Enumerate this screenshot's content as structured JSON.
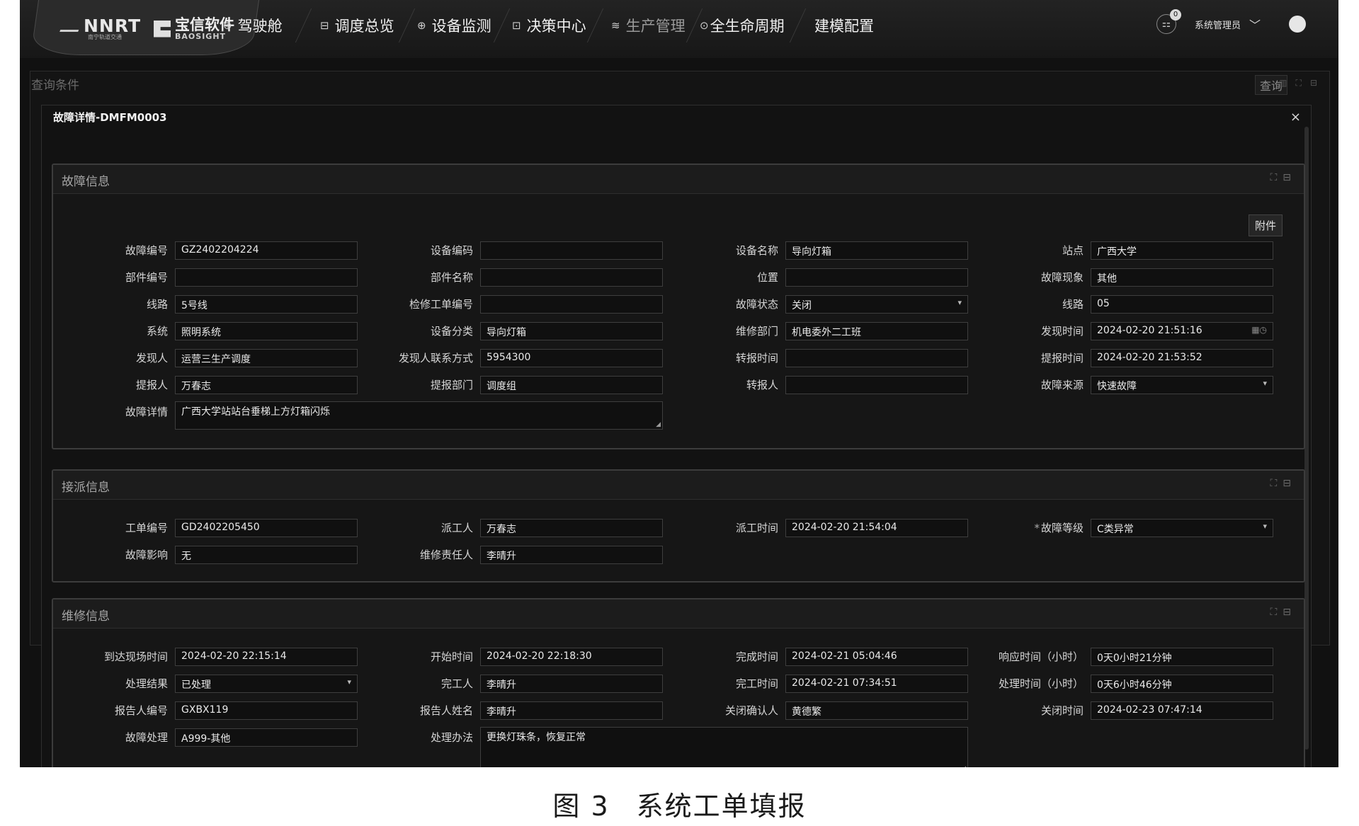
{
  "brand": {
    "logo_main": "NNRT",
    "logo_sub": "南宁轨道交通",
    "partner_cn": "宝信软件",
    "partner_en": "BAOSIGHT"
  },
  "nav": {
    "items": [
      {
        "label": "驾驶舱",
        "icon": "dashboard-icon"
      },
      {
        "label": "调度总览",
        "icon": "monitor-icon"
      },
      {
        "label": "设备监测",
        "icon": "target-icon"
      },
      {
        "label": "决策中心",
        "icon": "chart-icon"
      },
      {
        "label": "生产管理",
        "icon": "layers-icon"
      },
      {
        "label": "全生命周期",
        "icon": "cycle-icon"
      },
      {
        "label": "建模配置",
        "icon": ""
      }
    ],
    "notification_count": "0",
    "user": "系统管理员"
  },
  "query": {
    "title": "查询条件",
    "search_label": "查询"
  },
  "modal": {
    "title": "故障详情-DMFM0003",
    "close": "×"
  },
  "fault": {
    "title": "故障信息",
    "attach": "附件",
    "fields": {
      "fault_no": {
        "label": "故障编号",
        "value": "GZ2402204224"
      },
      "equip_code": {
        "label": "设备编码",
        "value": ""
      },
      "equip_name": {
        "label": "设备名称",
        "value": "导向灯箱"
      },
      "station": {
        "label": "站点",
        "value": "广西大学"
      },
      "part_no": {
        "label": "部件编号",
        "value": ""
      },
      "part_name": {
        "label": "部件名称",
        "value": ""
      },
      "position": {
        "label": "位置",
        "value": ""
      },
      "phenomenon": {
        "label": "故障现象",
        "value": "其他"
      },
      "line": {
        "label": "线路",
        "value": "5号线"
      },
      "repair_order_no": {
        "label": "检修工单编号",
        "value": ""
      },
      "status": {
        "label": "故障状态",
        "value": "关闭"
      },
      "line2": {
        "label": "线路",
        "value": "05"
      },
      "system": {
        "label": "系统",
        "value": "照明系统"
      },
      "equip_class": {
        "label": "设备分类",
        "value": "导向灯箱"
      },
      "repair_dept": {
        "label": "维修部门",
        "value": "机电委外二工班"
      },
      "found_time": {
        "label": "发现时间",
        "value": "2024-02-20 21:51:16"
      },
      "finder": {
        "label": "发现人",
        "value": "运营三生产调度"
      },
      "finder_contact": {
        "label": "发现人联系方式",
        "value": "5954300"
      },
      "transfer_time": {
        "label": "转报时间",
        "value": ""
      },
      "report_time": {
        "label": "提报时间",
        "value": "2024-02-20 21:53:52"
      },
      "reporter": {
        "label": "提报人",
        "value": "万春志"
      },
      "report_dept": {
        "label": "提报部门",
        "value": "调度组"
      },
      "transfer_person": {
        "label": "转报人",
        "value": ""
      },
      "source": {
        "label": "故障来源",
        "value": "快速故障"
      },
      "detail": {
        "label": "故障详情",
        "value": "广西大学站站台垂梯上方灯箱闪烁"
      }
    }
  },
  "dispatch": {
    "title": "接派信息",
    "fields": {
      "order_no": {
        "label": "工单编号",
        "value": "GD2402205450"
      },
      "dispatcher": {
        "label": "派工人",
        "value": "万春志"
      },
      "dispatch_time": {
        "label": "派工时间",
        "value": "2024-02-20 21:54:04"
      },
      "level": {
        "label": "故障等级",
        "value": "C类异常"
      },
      "impact": {
        "label": "故障影响",
        "value": "无"
      },
      "responsible": {
        "label": "维修责任人",
        "value": "李晴升"
      }
    }
  },
  "repair": {
    "title": "维修信息",
    "fields": {
      "arrive_time": {
        "label": "到达现场时间",
        "value": "2024-02-20 22:15:14"
      },
      "start_time": {
        "label": "开始时间",
        "value": "2024-02-20 22:18:30"
      },
      "finish_time": {
        "label": "完成时间",
        "value": "2024-02-21 05:04:46"
      },
      "response_time": {
        "label": "响应时间（小时）",
        "value": "0天0小时21分钟"
      },
      "result": {
        "label": "处理结果",
        "value": "已处理"
      },
      "worker": {
        "label": "完工人",
        "value": "李晴升"
      },
      "complete_time": {
        "label": "完工时间",
        "value": "2024-02-21 07:34:51"
      },
      "handle_time": {
        "label": "处理时间（小时）",
        "value": "0天6小时46分钟"
      },
      "reporter_no": {
        "label": "报告人编号",
        "value": "GXBX119"
      },
      "reporter_name": {
        "label": "报告人姓名",
        "value": "李晴升"
      },
      "close_confirm": {
        "label": "关闭确认人",
        "value": "黄德繁"
      },
      "close_time": {
        "label": "关闭时间",
        "value": "2024-02-23 07:47:14"
      },
      "handling": {
        "label": "故障处理",
        "value": "A999-其他"
      },
      "method": {
        "label": "处理办法",
        "value": "更换灯珠条，恢复正常"
      }
    }
  },
  "caption": {
    "number": "图 3",
    "text": "系统工单填报"
  }
}
